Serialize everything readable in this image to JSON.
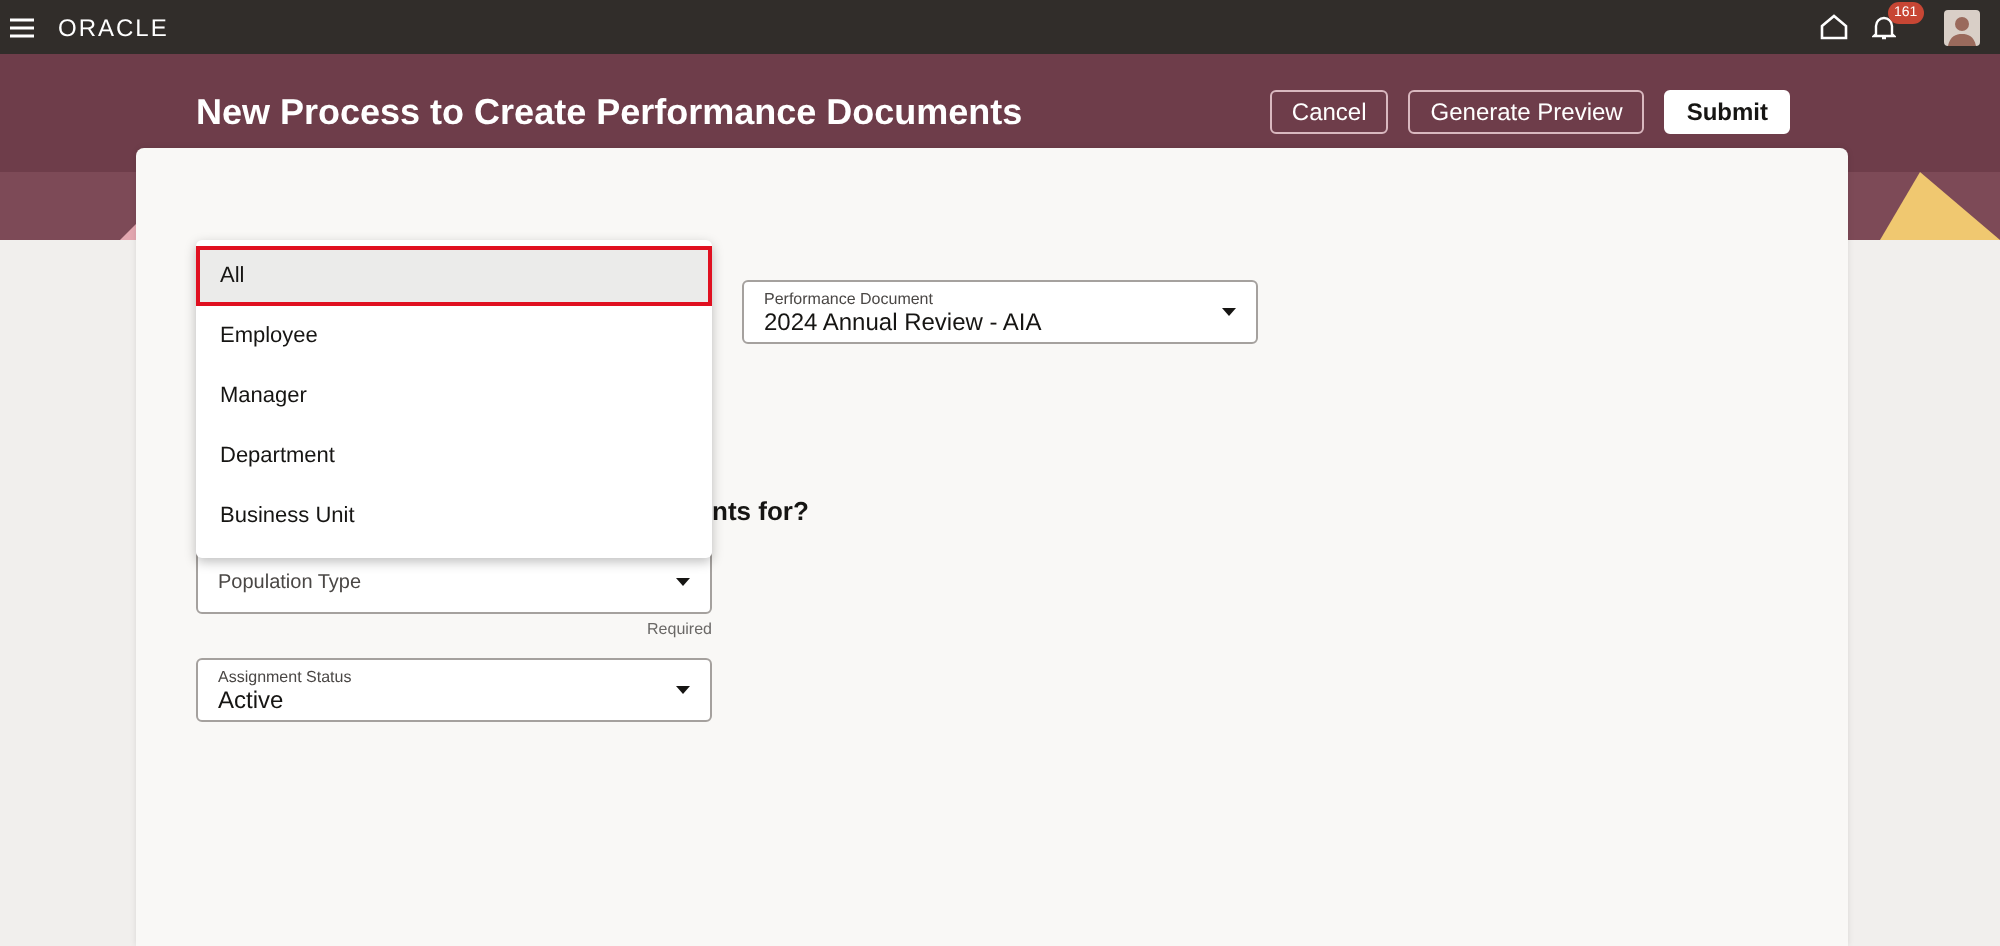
{
  "header": {
    "logo": "ORACLE",
    "notification_count": "161"
  },
  "page": {
    "title": "New Process to Create Performance Documents",
    "buttons": [
      {
        "label": "Cancel",
        "kind": "outline"
      },
      {
        "label": "Generate Preview",
        "kind": "outline"
      },
      {
        "label": "Submit",
        "kind": "primary"
      }
    ]
  },
  "dropdown": {
    "options": [
      {
        "label": "All",
        "selected": true
      },
      {
        "label": "Employee",
        "selected": false
      },
      {
        "label": "Manager",
        "selected": false
      },
      {
        "label": "Department",
        "selected": false
      },
      {
        "label": "Business Unit",
        "selected": false
      }
    ]
  },
  "performance_document": {
    "label": "Performance Document",
    "value": "2024 Annual Review - AIA"
  },
  "heading_fragment": "nts for?",
  "population_type": {
    "placeholder": "Population Type",
    "helper": "Required"
  },
  "assignment_status": {
    "label": "Assignment Status",
    "value": "Active"
  }
}
